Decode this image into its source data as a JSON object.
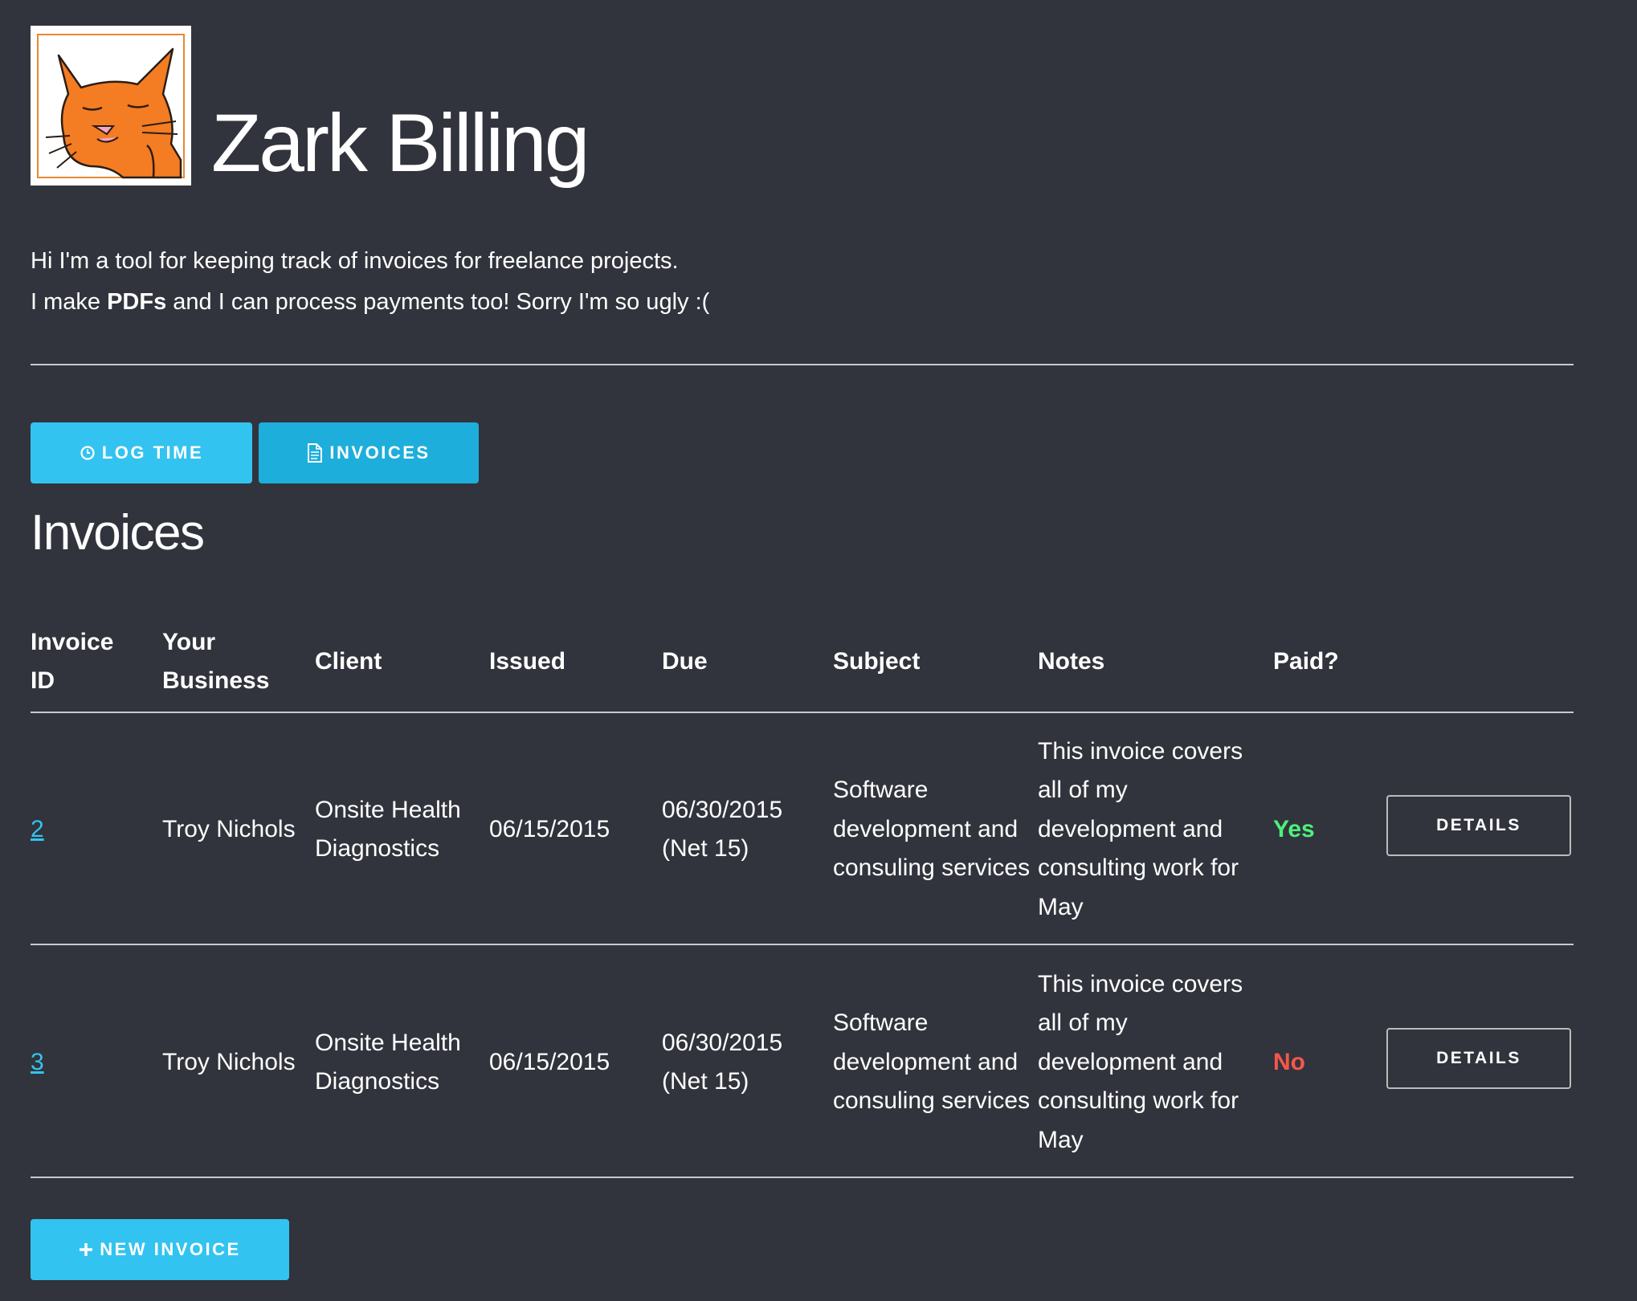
{
  "app": {
    "title": "Zark Billing",
    "intro_line1": "Hi I'm a tool for keeping track of invoices for freelance projects.",
    "intro_line2_prefix": "I make ",
    "intro_line2_bold": "PDFs",
    "intro_line2_suffix": " and I can process payments too! Sorry I'm so ugly :(",
    "logo_icon": "orange-cat-icon"
  },
  "nav": {
    "log_time_label": "LOG TIME",
    "log_time_icon": "clock-icon",
    "invoices_label": "INVOICES",
    "invoices_icon": "document-icon"
  },
  "invoices": {
    "title": "Invoices",
    "headers": {
      "invoice_id_1": "Invoice",
      "invoice_id_2": "ID",
      "business_1": "Your",
      "business_2": "Business",
      "client": "Client",
      "issued": "Issued",
      "due": "Due",
      "subject": "Subject",
      "notes": "Notes",
      "paid": "Paid?"
    },
    "rows": [
      {
        "id": "2",
        "business": "Troy Nichols",
        "client": "Onsite Health Diagnostics",
        "issued": "06/15/2015",
        "due": "06/30/2015 (Net 15)",
        "subject": "Software development and consuling services",
        "notes": "This invoice covers all of my development and consulting work for May",
        "paid": "Yes",
        "action": "DETAILS"
      },
      {
        "id": "3",
        "business": "Troy Nichols",
        "client": "Onsite Health Diagnostics",
        "issued": "06/15/2015",
        "due": "06/30/2015 (Net 15)",
        "subject": "Software development and consuling services",
        "notes": "This invoice covers all of my development and consulting work for May",
        "paid": "No",
        "action": "DETAILS"
      }
    ],
    "new_invoice_label": "NEW INVOICE",
    "new_invoice_icon": "plus-icon"
  },
  "colors": {
    "background": "#31343c",
    "accent": "#33c3f0",
    "accent_dark": "#1eaedb",
    "paid_yes": "#4ef07a",
    "paid_no": "#f4574a"
  }
}
